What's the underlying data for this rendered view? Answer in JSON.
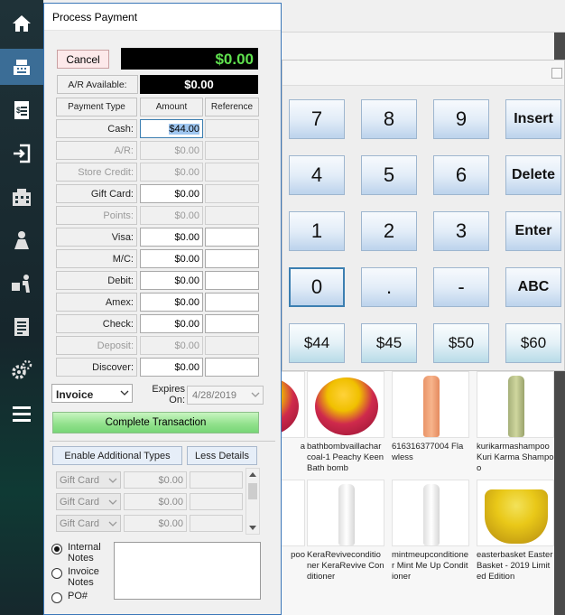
{
  "dialog": {
    "title": "Process Payment",
    "cancel_label": "Cancel",
    "total_due": "$0.00",
    "ar_available_label": "A/R  Available:",
    "ar_available_value": "$0.00",
    "headers": {
      "payment_type": "Payment Type",
      "amount": "Amount",
      "reference": "Reference"
    },
    "payments": [
      {
        "label": "Cash:",
        "amount": "$44.00",
        "enabled": true,
        "selected": true
      },
      {
        "label": "A/R:",
        "amount": "$0.00",
        "enabled": false
      },
      {
        "label": "Store Credit:",
        "amount": "$0.00",
        "enabled": false
      },
      {
        "label": "Gift Card:",
        "amount": "$0.00",
        "enabled": true
      },
      {
        "label": "Points:",
        "amount": "$0.00",
        "enabled": false
      },
      {
        "label": "Visa:",
        "amount": "$0.00",
        "enabled": true
      },
      {
        "label": "M/C:",
        "amount": "$0.00",
        "enabled": true
      },
      {
        "label": "Debit:",
        "amount": "$0.00",
        "enabled": true
      },
      {
        "label": "Amex:",
        "amount": "$0.00",
        "enabled": true
      },
      {
        "label": "Check:",
        "amount": "$0.00",
        "enabled": true
      },
      {
        "label": "Deposit:",
        "amount": "$0.00",
        "enabled": false
      },
      {
        "label": "Discover:",
        "amount": "$0.00",
        "enabled": true
      }
    ],
    "document_type": "Invoice",
    "expires_label": "Expires On:",
    "expires_value": "4/28/2019",
    "complete_label": "Complete Transaction",
    "enable_additional_label": "Enable Additional Types",
    "less_details_label": "Less Details",
    "additional_rows": [
      {
        "type": "Gift Card",
        "amount": "$0.00"
      },
      {
        "type": "Gift Card",
        "amount": "$0.00"
      },
      {
        "type": "Gift Card",
        "amount": "$0.00"
      }
    ],
    "note_options": [
      {
        "label": "Internal Notes",
        "checked": true
      },
      {
        "label": "Invoice Notes",
        "checked": false
      },
      {
        "label": "PO#",
        "checked": false
      }
    ]
  },
  "keypad": {
    "keys": [
      {
        "label": "7",
        "kind": "digit"
      },
      {
        "label": "8",
        "kind": "digit"
      },
      {
        "label": "9",
        "kind": "digit"
      },
      {
        "label": "Insert",
        "kind": "word"
      },
      {
        "label": "4",
        "kind": "digit"
      },
      {
        "label": "5",
        "kind": "digit"
      },
      {
        "label": "6",
        "kind": "digit"
      },
      {
        "label": "Delete",
        "kind": "word"
      },
      {
        "label": "1",
        "kind": "digit"
      },
      {
        "label": "2",
        "kind": "digit"
      },
      {
        "label": "3",
        "kind": "digit"
      },
      {
        "label": "Enter",
        "kind": "word"
      },
      {
        "label": "0",
        "kind": "digit"
      },
      {
        "label": ".",
        "kind": "digit"
      },
      {
        "label": "-",
        "kind": "digit"
      },
      {
        "label": "ABC",
        "kind": "word"
      },
      {
        "label": "$44",
        "kind": "money"
      },
      {
        "label": "$45",
        "kind": "money"
      },
      {
        "label": "$50",
        "kind": "money"
      },
      {
        "label": "$60",
        "kind": "money"
      }
    ]
  },
  "products": [
    {
      "caption": "a",
      "image": "bath-bomb"
    },
    {
      "caption": "bathbombvaillacharcoal-1 Peachy Keen Bath bomb",
      "image": "bath-bomb"
    },
    {
      "caption": "616316377004 Flawless",
      "image": "orange-bottle"
    },
    {
      "caption": "kurikarmashampoo Kuri Karma Shampoo",
      "image": "green-bottle"
    },
    {
      "caption": "poo",
      "image": "partial"
    },
    {
      "caption": "KeraReviveconditioner KeraRevive Conditioner",
      "image": "white-bottle"
    },
    {
      "caption": "mintmeupconditioner Mint Me Up Conditioner",
      "image": "white-bottle"
    },
    {
      "caption": "easterbasket Easter Basket - 2019 Limited Edition",
      "image": "basket"
    }
  ],
  "sidebar": {
    "items": [
      "home-icon",
      "register-icon",
      "invoice-icon",
      "login-icon",
      "building-icon",
      "customers-icon",
      "delivery-icon",
      "reports-icon",
      "settings-icon",
      "menu-icon"
    ],
    "active_index": 1
  },
  "colors": {
    "accent": "#3b6d96",
    "total_text": "#5fe04e",
    "complete_button": "#8fe08a",
    "sidebar_bg": "#1f3238"
  }
}
